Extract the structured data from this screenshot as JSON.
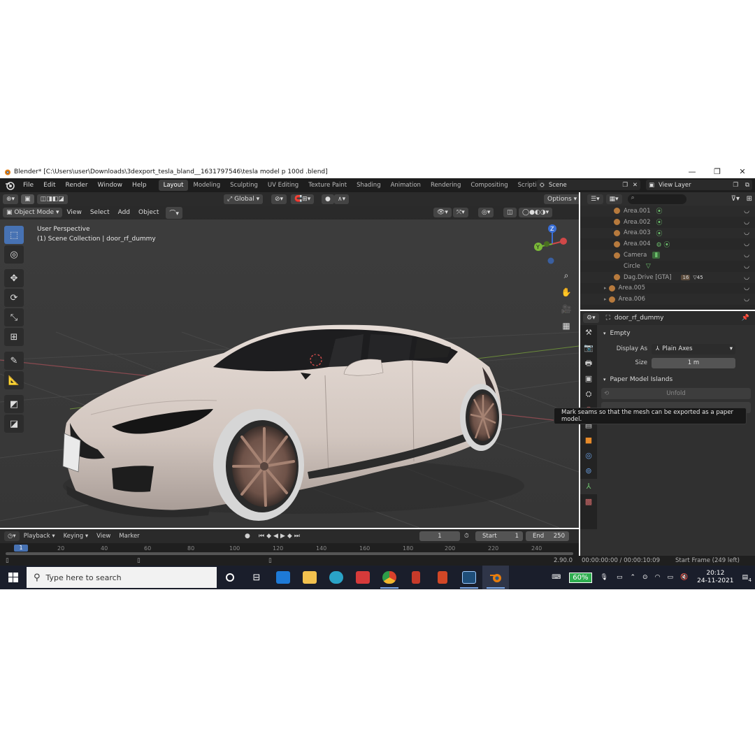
{
  "window": {
    "title": "Blender* [C:\\Users\\user\\Downloads\\3dexport_tesla_bland__1631797546\\tesla model p 100d .blend]",
    "minimize_icon": "minimize-icon",
    "maximize_icon": "maximize-icon",
    "close_icon": "close-icon"
  },
  "menu": {
    "items": [
      "File",
      "Edit",
      "Render",
      "Window",
      "Help"
    ]
  },
  "workspaces": {
    "tabs": [
      "Layout",
      "Modeling",
      "Sculpting",
      "UV Editing",
      "Texture Paint",
      "Shading",
      "Animation",
      "Rendering",
      "Compositing",
      "Scripting"
    ],
    "active": "Layout",
    "add": "+"
  },
  "scene": {
    "name": "Scene",
    "view_layer": "View Layer"
  },
  "viewport": {
    "transform_orientation": "Global",
    "options_label": "Options",
    "mode": "Object Mode",
    "header_menus": [
      "View",
      "Select",
      "Add",
      "Object"
    ],
    "perspective_label": "User Perspective",
    "collection_label": "(1) Scene Collection | door_rf_dummy",
    "gizmo": {
      "x": "X",
      "y": "Y",
      "z": "Z"
    }
  },
  "outliner": {
    "rows": [
      {
        "label": "Area.001"
      },
      {
        "label": "Area.002"
      },
      {
        "label": "Area.003"
      },
      {
        "label": "Area.004"
      },
      {
        "label": "Camera"
      },
      {
        "label": "Circle"
      },
      {
        "label": "Dag.Drive [GTA]",
        "badges": [
          "16",
          "45"
        ]
      },
      {
        "label": "Area.005"
      },
      {
        "label": "Area.006"
      }
    ]
  },
  "properties": {
    "object_name": "door_rf_dummy",
    "panel_empty": "Empty",
    "display_as_label": "Display As",
    "display_as_value": "Plain Axes",
    "size_label": "Size",
    "size_value": "1 m",
    "panel_paper": "Paper Model Islands",
    "unfold_label": "Unfold",
    "tooltip": "Mark seams so that the mesh can be exported as a paper model."
  },
  "timeline": {
    "menus": [
      "Playback",
      "Keying",
      "View",
      "Marker"
    ],
    "current_frame": "1",
    "start_label": "Start",
    "start_value": "1",
    "end_label": "End",
    "end_value": "250",
    "ruler": [
      "1",
      "20",
      "40",
      "60",
      "80",
      "100",
      "120",
      "140",
      "160",
      "180",
      "200",
      "220",
      "240"
    ]
  },
  "status": {
    "version": "2.90.0",
    "time": "00:00:00:00 / 00:00:10:09",
    "frame_info": "Start Frame (249 left)"
  },
  "taskbar": {
    "search_placeholder": "Type here to search",
    "battery": "60%",
    "time": "20:12",
    "date": "24-11-2021",
    "notifications": "4"
  },
  "colors": {
    "accent": "#4772b3",
    "blender_orange": "#e87d0d",
    "car_body": "#d9cdc6"
  }
}
